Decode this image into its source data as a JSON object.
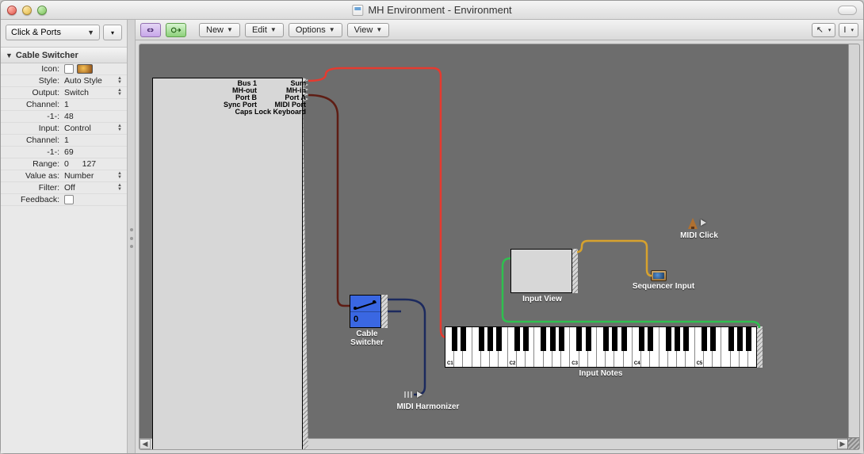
{
  "window": {
    "title": "MH Environment - Environment"
  },
  "layer_selector": {
    "selected": "Click & Ports"
  },
  "inspector": {
    "header": "Cable Switcher",
    "rows": {
      "icon_label": "Icon:",
      "style_label": "Style:",
      "style_value": "Auto Style",
      "output_label": "Output:",
      "output_value": "Switch",
      "channel1_label": "Channel:",
      "channel1_value": "1",
      "neg1a_label": "-1-:",
      "neg1a_value": "48",
      "input_label": "Input:",
      "input_value": "Control",
      "channel2_label": "Channel:",
      "channel2_value": "1",
      "neg1b_label": "-1-:",
      "neg1b_value": "69",
      "range_label": "Range:",
      "range_min": "0",
      "range_max": "127",
      "valueas_label": "Value as:",
      "valueas_value": "Number",
      "filter_label": "Filter:",
      "filter_value": "Off",
      "feedback_label": "Feedback:"
    }
  },
  "toolbar": {
    "new_label": "New",
    "edit_label": "Edit",
    "options_label": "Options",
    "view_label": "View"
  },
  "physical_input": {
    "left_ports": [
      "Bus 1",
      "MH-out",
      "Port B",
      "Sync Port"
    ],
    "right_ports": [
      "Sum",
      "MH-in",
      "Port A",
      "MIDI Port",
      "Caps Lock Keyboard"
    ]
  },
  "nodes": {
    "cable_switcher": {
      "label": "Cable Switcher",
      "digit": "0"
    },
    "input_view": {
      "label": "Input View"
    },
    "input_notes": {
      "label": "Input Notes",
      "octave_labels": [
        "C1",
        "C2",
        "C3",
        "C4",
        "C5"
      ]
    },
    "midi_click": {
      "label": "MIDI Click"
    },
    "sequencer_input": {
      "label": "Sequencer Input"
    },
    "midi_harmonizer": {
      "label": "MIDI Harmonizer"
    }
  },
  "cable_colors": {
    "red": "#e53a2f",
    "dark_red": "#5e1d14",
    "navy": "#1c2a5e",
    "green": "#2fbf4f",
    "gold": "#d7a22e"
  }
}
